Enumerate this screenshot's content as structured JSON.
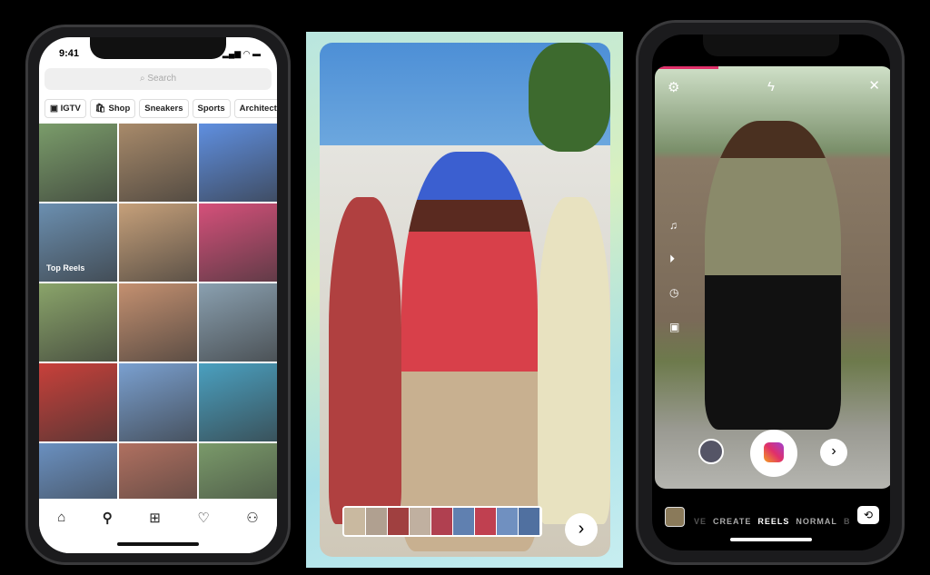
{
  "explore": {
    "time": "9:41",
    "search_placeholder": "Search",
    "chips": [
      "IGTV",
      "Shop",
      "Sneakers",
      "Sports",
      "Architect"
    ],
    "top_reels_label": "Top Reels",
    "grid_colors": [
      "#7a9c6a",
      "#a88a6a",
      "#5f8fe0",
      "#6b8fb0",
      "#c6a07a",
      "#d5507a",
      "#8aa46a",
      "#c49070",
      "#8aa0b0",
      "#c8403a",
      "#7aa0d0",
      "#4aa0c0",
      "#6a90c0",
      "#b07060",
      "#7a9a6a"
    ],
    "nav": [
      "home-icon",
      "search-icon",
      "add-icon",
      "heart-icon",
      "profile-icon"
    ]
  },
  "editor": {
    "next_label": "›"
  },
  "camera": {
    "modes": [
      "VE",
      "CREATE",
      "REELS",
      "NORMAL",
      "B"
    ],
    "active_mode": "REELS",
    "next_label": "›",
    "accent": "#e0306a"
  }
}
